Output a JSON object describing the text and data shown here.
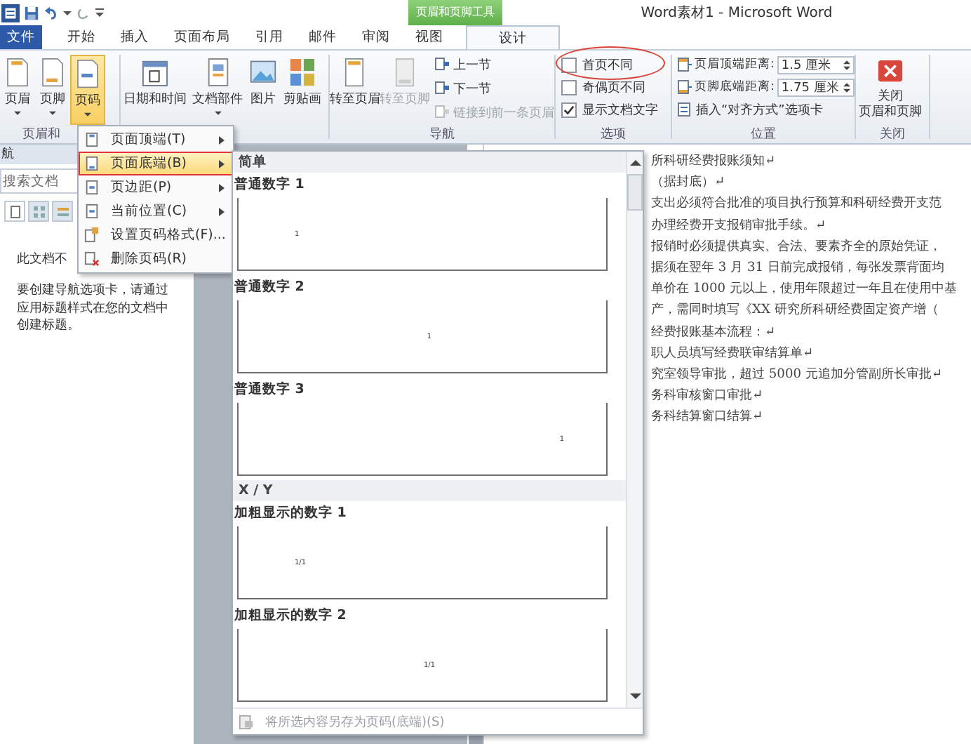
{
  "title_bar": {
    "title": "Word素材1 - Microsoft Word",
    "context_tab": "页眉和页脚工具"
  },
  "tabs": [
    {
      "label": "文件",
      "kind": "file",
      "selected": false
    },
    {
      "label": "开始",
      "kind": "tab",
      "selected": false
    },
    {
      "label": "插入",
      "kind": "tab",
      "selected": false
    },
    {
      "label": "页面布局",
      "kind": "tab",
      "selected": false
    },
    {
      "label": "引用",
      "kind": "tab",
      "selected": false
    },
    {
      "label": "邮件",
      "kind": "tab",
      "selected": false
    },
    {
      "label": "审阅",
      "kind": "tab",
      "selected": false
    },
    {
      "label": "视图",
      "kind": "tab",
      "selected": false
    },
    {
      "label": "设计",
      "kind": "context",
      "selected": true
    }
  ],
  "header_footer_group": {
    "label": "页眉和",
    "buttons": [
      {
        "label": "页眉",
        "dropdown": true,
        "selected": false
      },
      {
        "label": "页脚",
        "dropdown": true,
        "selected": false
      },
      {
        "label": "页码",
        "dropdown": true,
        "selected": true
      }
    ]
  },
  "insert_group": {
    "buttons": [
      {
        "label": "日期和时间",
        "dropdown": false
      },
      {
        "label": "文档部件",
        "dropdown": true
      },
      {
        "label": "图片",
        "dropdown": false
      },
      {
        "label": "剪贴画",
        "dropdown": false
      }
    ]
  },
  "navigation_group": {
    "label": "导航",
    "large_buttons": [
      {
        "label": "转至页眉",
        "disabled": false
      },
      {
        "label": "转至页脚",
        "disabled": true
      }
    ],
    "small_buttons": [
      {
        "label": "上一节",
        "disabled": false
      },
      {
        "label": "下一节",
        "disabled": false
      },
      {
        "label": "链接到前一条页眉",
        "disabled": true
      }
    ]
  },
  "options_group": {
    "label": "选项",
    "checkboxes": [
      {
        "label": "首页不同",
        "checked": false
      },
      {
        "label": "奇偶页不同",
        "checked": false
      },
      {
        "label": "显示文档文字",
        "checked": true
      }
    ]
  },
  "position_group": {
    "label": "位置",
    "spinners": [
      {
        "label": "页眉顶端距离:",
        "value": "1.5 厘米"
      },
      {
        "label": "页脚底端距离:",
        "value": "1.75 厘米"
      }
    ],
    "insert_tab_button": "插入“对齐方式”选项卡"
  },
  "close_group": {
    "label": "关闭",
    "button_lines": [
      "关闭",
      "页眉和页脚"
    ]
  },
  "nav_pane": {
    "title": "航",
    "search_placeholder": "搜索文档",
    "view_tabs": [
      {
        "selected": true
      },
      {
        "selected": false
      },
      {
        "selected": false
      }
    ],
    "message_cut": "此文档不",
    "message": "要创建导航选项卡，请通过应用标题样式在您的文档中创建标题。"
  },
  "page_number_menu": {
    "items": [
      {
        "label": "页面顶端(T)",
        "submenu": true,
        "selected": false
      },
      {
        "label": "页面底端(B)",
        "submenu": true,
        "selected": true
      },
      {
        "label": "页边距(P)",
        "submenu": true,
        "selected": false
      },
      {
        "label": "当前位置(C)",
        "submenu": true,
        "selected": false
      },
      {
        "label": "设置页码格式(F)...",
        "submenu": false,
        "selected": false
      },
      {
        "label": "删除页码(R)",
        "submenu": false,
        "selected": false
      }
    ]
  },
  "gallery": {
    "sections": [
      {
        "title": "简单",
        "items": [
          {
            "label": "普通数字 1",
            "kind": "left",
            "preview": "1"
          },
          {
            "label": "普通数字 2",
            "kind": "center",
            "preview": "1"
          },
          {
            "label": "普通数字 3",
            "kind": "right",
            "preview": "1"
          }
        ]
      },
      {
        "title": "X / Y",
        "items": [
          {
            "label": "加粗显示的数字 1",
            "kind": "left",
            "preview": "1/1"
          },
          {
            "label": "加粗显示的数字 2",
            "kind": "center",
            "preview": "1/1"
          }
        ]
      }
    ],
    "footer": {
      "label": "将所选内容另存为页码(底端)(S)",
      "disabled": true
    }
  },
  "document": {
    "lines": [
      "所科研经费报账须知↵",
      "（据封底）↵",
      "支出必须符合批准的项目执行预算和科研经费开支范",
      "办理经费开支报销审批手续。↵",
      "报销时必须提供真实、合法、要素齐全的原始凭证，",
      "据须在翌年 3 月 31 日前完成报销，每张发票背面均",
      "单价在 1000 元以上，使用年限超过一年且在使用中基",
      "产，需同时填写《XX 研究所科研经费固定资产增（",
      "经费报账基本流程：↵",
      "职人员填写经费联审结算单↵",
      "究室领导审批，超过 5000 元追加分管副所长审批↵",
      "务科审核窗口审批↵",
      "务科结算窗口结算↵"
    ]
  }
}
